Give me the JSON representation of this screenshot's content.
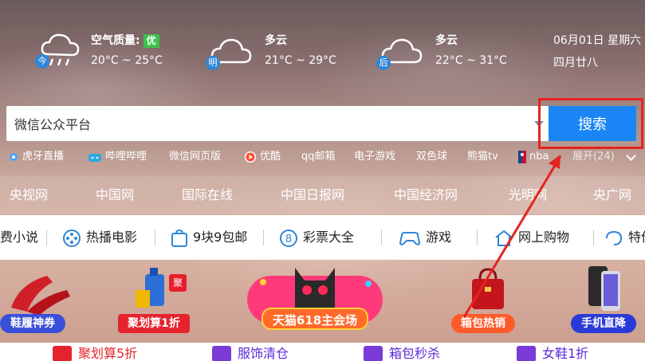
{
  "weather": {
    "today": {
      "badge": "今",
      "title": "空气质量:",
      "aqi": "优",
      "temp": "20°C ~ 25°C"
    },
    "tomorrow": {
      "badge": "明",
      "title": "多云",
      "temp": "21°C ~ 29°C"
    },
    "after": {
      "badge": "后",
      "title": "多云",
      "temp": "22°C ~ 31°C"
    },
    "date": "06月01日 星期六",
    "lunar": "四月廿八"
  },
  "search": {
    "value": "微信公众平台",
    "button": "搜索"
  },
  "quick_links": [
    "虎牙直播",
    "哔哩哔哩",
    "微信网页版",
    "优酷",
    "qq邮箱",
    "电子游戏",
    "双色球",
    "熊猫tv",
    "nba"
  ],
  "expand": "展开(24)",
  "sites": [
    "央视网",
    "中国网",
    "国际在线",
    "中国日报网",
    "中国经济网",
    "光明网",
    "央广网"
  ],
  "categories": [
    "费小说",
    "热播电影",
    "9块9包邮",
    "彩票大全",
    "游戏",
    "网上购物",
    "特价"
  ],
  "banners": [
    "鞋履神券",
    "聚划算1折",
    "天猫618主会场",
    "箱包热销",
    "手机直降"
  ],
  "banner_badge": "聚",
  "bottom": [
    "聚划算5折",
    "服饰清仓",
    "箱包秒杀",
    "女鞋1折"
  ],
  "colors": {
    "accent": "#1a86f5",
    "highlight": "#e52420",
    "aqi": "#3ec24a"
  }
}
